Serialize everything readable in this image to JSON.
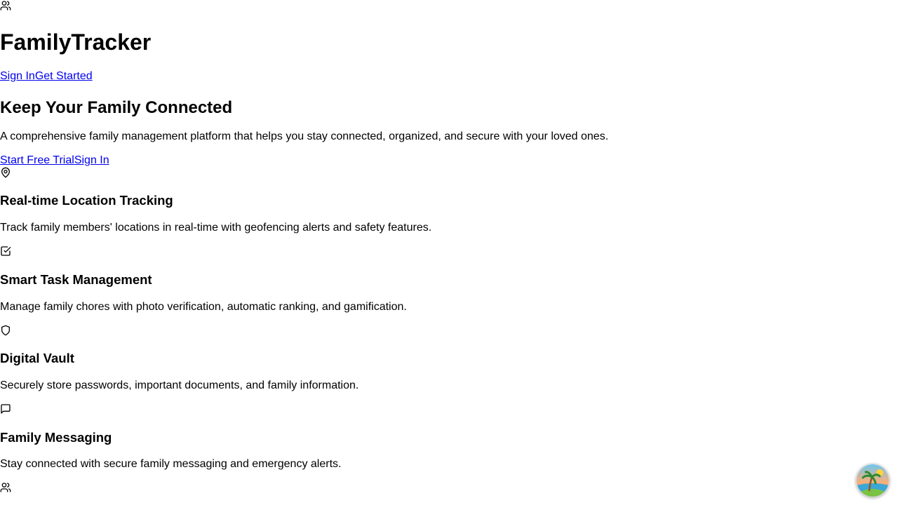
{
  "header": {
    "logo_icon": "users-icon",
    "brand": "FamilyTracker",
    "nav": [
      {
        "label": "Sign In"
      },
      {
        "label": "Get Started"
      }
    ]
  },
  "hero": {
    "title": "Keep Your Family Connected",
    "description": "A comprehensive family management platform that helps you stay connected, organized, and secure with your loved ones.",
    "cta": [
      {
        "label": "Start Free Trial"
      },
      {
        "label": "Sign In"
      }
    ]
  },
  "features": [
    {
      "icon": "map-pin-icon",
      "title": "Real-time Location Tracking",
      "description": "Track family members' locations in real-time with geofencing alerts and safety features."
    },
    {
      "icon": "check-square-icon",
      "title": "Smart Task Management",
      "description": "Manage family chores with photo verification, automatic ranking, and gamification."
    },
    {
      "icon": "shield-icon",
      "title": "Digital Vault",
      "description": "Securely store passwords, important documents, and family information."
    },
    {
      "icon": "message-square-icon",
      "title": "Family Messaging",
      "description": "Stay connected with secure family messaging and emergency alerts."
    },
    {
      "icon": "users-icon"
    }
  ],
  "floating_button": {
    "icon": "tropical-island-icon"
  }
}
